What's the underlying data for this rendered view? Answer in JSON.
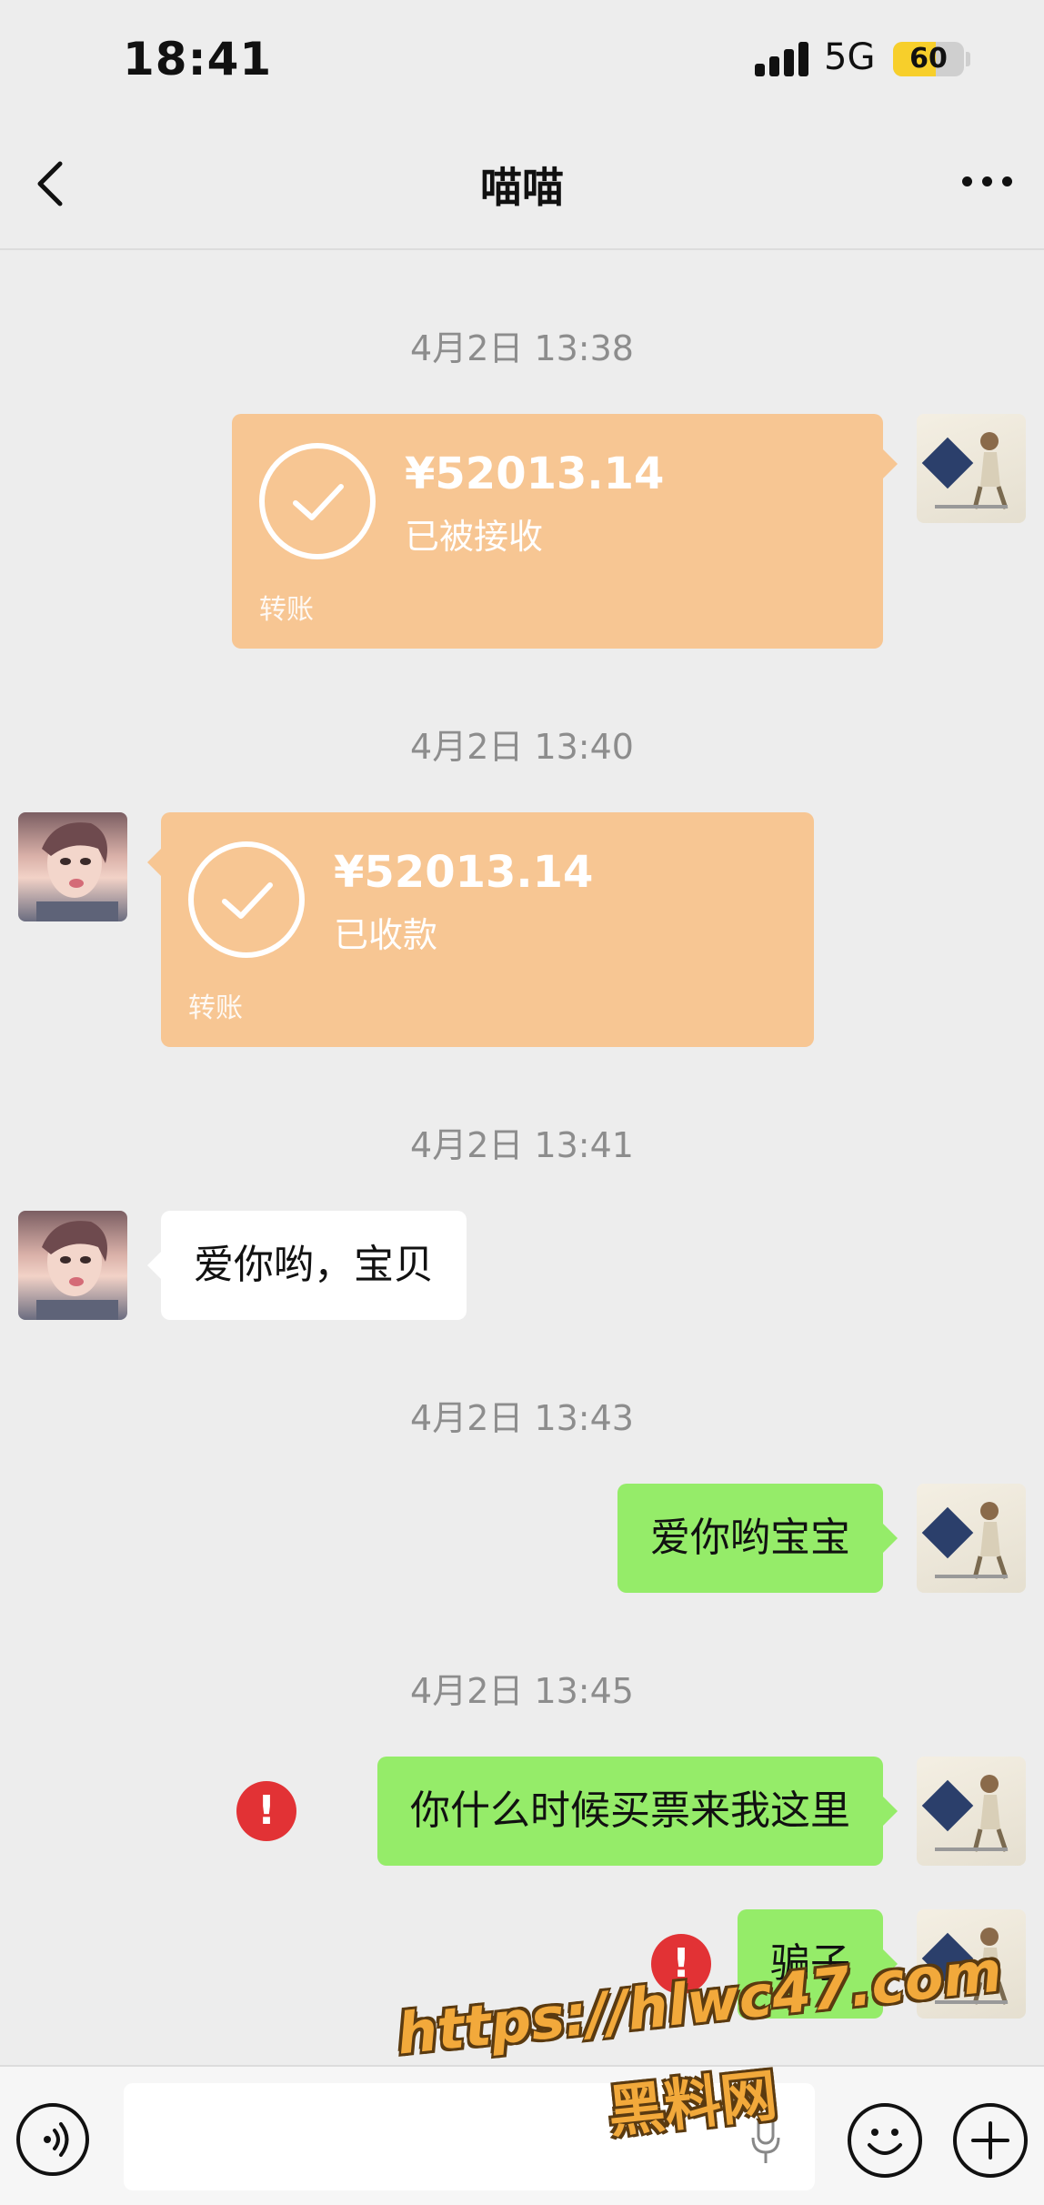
{
  "status_bar": {
    "time": "18:41",
    "network": "5G",
    "battery": "60",
    "battery_level": 0.6
  },
  "nav": {
    "title": "喵喵"
  },
  "messages": [
    {
      "type": "timestamp",
      "text": "4月2日 13:38"
    },
    {
      "type": "transfer",
      "side": "me",
      "amount": "¥52013.14",
      "status": "已被接收",
      "label": "转账"
    },
    {
      "type": "timestamp",
      "text": "4月2日 13:40"
    },
    {
      "type": "transfer",
      "side": "her",
      "amount": "¥52013.14",
      "status": "已收款",
      "label": "转账"
    },
    {
      "type": "timestamp",
      "text": "4月2日 13:41"
    },
    {
      "type": "text",
      "side": "her",
      "text": "爱你哟，宝贝"
    },
    {
      "type": "timestamp",
      "text": "4月2日 13:43"
    },
    {
      "type": "text",
      "side": "me",
      "text": "爱你哟宝宝"
    },
    {
      "type": "timestamp",
      "text": "4月2日 13:45"
    },
    {
      "type": "text",
      "side": "me",
      "text": "你什么时候买票来我这里",
      "failed": true
    },
    {
      "type": "text",
      "side": "me",
      "text": "骗子",
      "failed": true
    }
  ],
  "error_mark": "!",
  "watermark": {
    "line1": "https://hlwc47.com",
    "line2": "黑料网"
  },
  "colors": {
    "background": "#ededed",
    "transfer": "#f7c693",
    "sent_bubble": "#95ec69",
    "received_bubble": "#ffffff",
    "error": "#e23235"
  },
  "icons": {
    "back": "chevron-left-icon",
    "more": "more-dots-icon",
    "voice": "voice-icon",
    "mic": "microphone-icon",
    "emoji": "emoji-icon",
    "plus": "plus-icon",
    "check": "check-icon"
  }
}
